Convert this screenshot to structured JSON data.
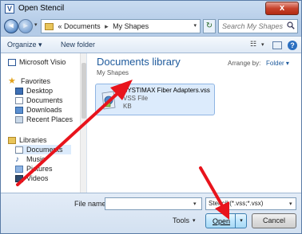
{
  "window": {
    "title": "Open Stencil",
    "close_glyph": "x",
    "app_icon_letter": "V"
  },
  "address": {
    "prefix": "«",
    "crumbs": [
      "Documents",
      "My Shapes"
    ],
    "separator": "▸"
  },
  "search": {
    "placeholder": "Search My Shapes"
  },
  "toolbar": {
    "organize_label": "Organize ▾",
    "new_folder_label": "New folder"
  },
  "nav": {
    "items": [
      {
        "label": "Microsoft Visio",
        "icon": "visio-icon"
      },
      {
        "label": "Favorites",
        "icon": "star-icon"
      },
      {
        "label": "Desktop",
        "icon": "desktop-icon"
      },
      {
        "label": "Documents",
        "icon": "documents-icon"
      },
      {
        "label": "Downloads",
        "icon": "downloads-icon"
      },
      {
        "label": "Recent Places",
        "icon": "recent-places-icon"
      },
      {
        "label": "Libraries",
        "icon": "libraries-icon"
      },
      {
        "label": "Documents",
        "icon": "documents-icon"
      },
      {
        "label": "Music",
        "icon": "music-icon"
      },
      {
        "label": "Pictures",
        "icon": "pictures-icon"
      },
      {
        "label": "Videos",
        "icon": "videos-icon"
      }
    ]
  },
  "content": {
    "library_title": "Documents library",
    "library_subtitle": "My Shapes",
    "arrange_label": "Arrange by:",
    "arrange_value": "Folder ▾",
    "file": {
      "name": "SYSTIMAX Fiber Adapters.vss",
      "type": "VSS File",
      "size": "KB"
    }
  },
  "bottom": {
    "file_name_label": "File name:",
    "file_name_value": "",
    "file_type_value": "Stencil (*.vss;*.vsx)",
    "tools_label": "Tools",
    "open_label": "Open",
    "cancel_label": "Cancel"
  },
  "colors": {
    "annotation_arrow": "#e8141c",
    "accent": "#1e5a9c"
  }
}
